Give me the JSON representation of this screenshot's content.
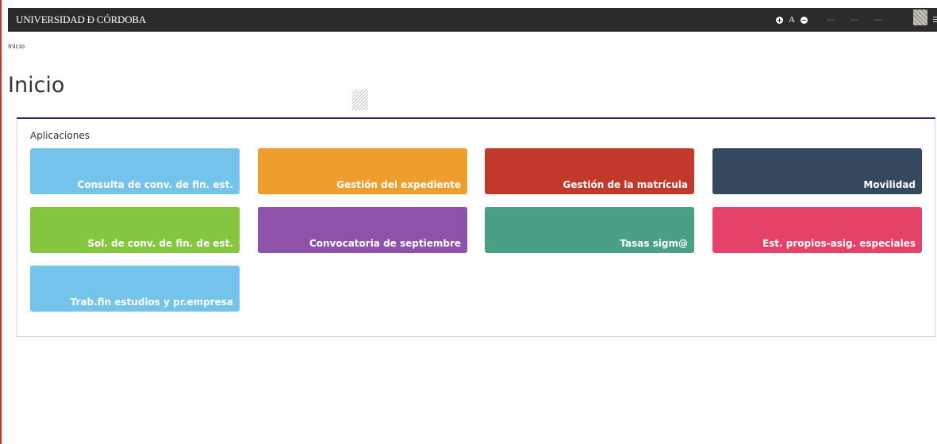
{
  "header": {
    "brand": "UNIVERSIDAD Ð CÓRDOBA",
    "zoom_in": "+",
    "font_toggle": "A",
    "zoom_out": "−"
  },
  "breadcrumb": {
    "current": "Inicio"
  },
  "page": {
    "title": "Inicio"
  },
  "apps": {
    "title": "Aplicaciones",
    "tiles": [
      {
        "label": "Consulta de conv. de fin. est.",
        "color": "#74c3ea"
      },
      {
        "label": "Gestión del expediente",
        "color": "#ee9e2d"
      },
      {
        "label": "Gestión de la matrícula",
        "color": "#c0392b"
      },
      {
        "label": "Movilidad",
        "color": "#34495e"
      },
      {
        "label": "Sol. de conv. de fin. de est.",
        "color": "#85c641"
      },
      {
        "label": "Convocatoria de septiembre",
        "color": "#8e53a9"
      },
      {
        "label": "Tasas sigm@",
        "color": "#4aa086"
      },
      {
        "label": "Est. propios-asig. especiales",
        "color": "#e5426a"
      },
      {
        "label": "Trab.fin estudios y pr.empresa",
        "color": "#74c3ea"
      }
    ]
  }
}
